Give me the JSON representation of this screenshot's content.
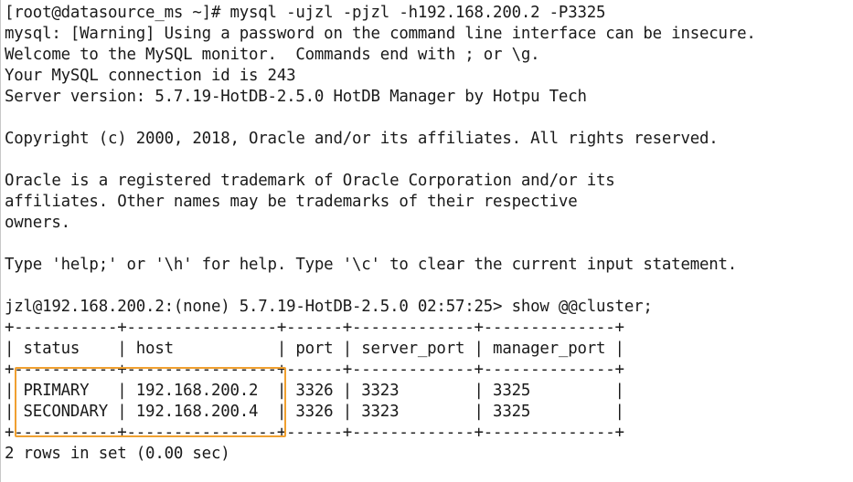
{
  "terminal": {
    "lines": [
      "[root@datasource_ms ~]# mysql -ujzl -pjzl -h192.168.200.2 -P3325",
      "mysql: [Warning] Using a password on the command line interface can be insecure.",
      "Welcome to the MySQL monitor.  Commands end with ; or \\g.",
      "Your MySQL connection id is 243",
      "Server version: 5.7.19-HotDB-2.5.0 HotDB Manager by Hotpu Tech",
      "",
      "Copyright (c) 2000, 2018, Oracle and/or its affiliates. All rights reserved.",
      "",
      "Oracle is a registered trademark of Oracle Corporation and/or its",
      "affiliates. Other names may be trademarks of their respective",
      "owners.",
      "",
      "Type 'help;' or '\\h' for help. Type '\\c' to clear the current input statement.",
      "",
      "jzl@192.168.200.2:(none) 5.7.19-HotDB-2.5.0 02:57:25> show @@cluster;",
      "+-----------+----------------+------+-------------+--------------+",
      "| status    | host           | port | server_port | manager_port |",
      "+-----------+----------------+------+-------------+--------------+",
      "| PRIMARY   | 192.168.200.2  | 3326 | 3323        | 3325         |",
      "| SECONDARY | 192.168.200.4  | 3326 | 3323        | 3325         |",
      "+-----------+----------------+------+-------------+--------------+",
      "2 rows in set (0.00 sec)"
    ]
  },
  "colors": {
    "background": "#ffffff",
    "text": "#1a1a1a",
    "highlight": "#f0a030"
  }
}
